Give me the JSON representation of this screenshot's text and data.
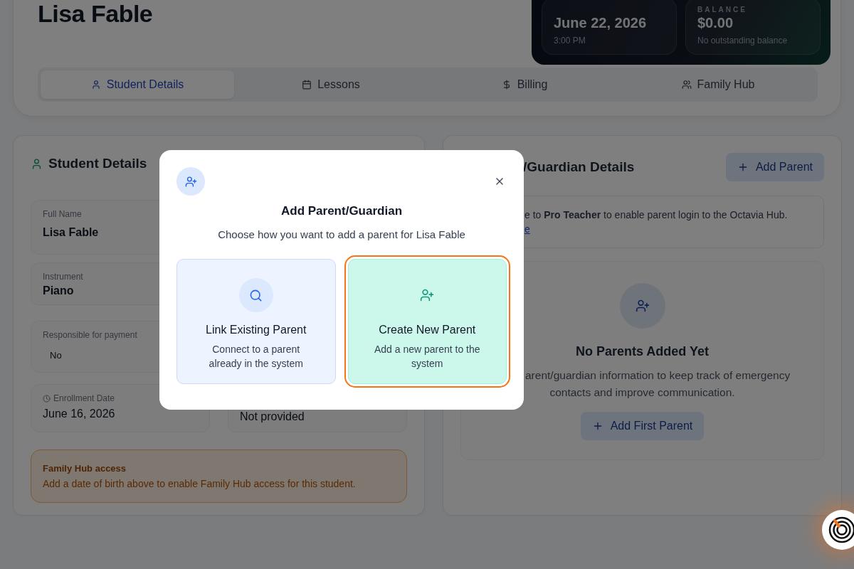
{
  "student_header": {
    "name": "Lisa Fable",
    "next_lesson": {
      "date": "June 22, 2026",
      "time": "3:00 PM"
    },
    "balance": {
      "label": "BALANCE",
      "amount": "$0.00",
      "note": "No outstanding balance"
    }
  },
  "tabs": [
    {
      "label": "Student Details",
      "selected": true
    },
    {
      "label": "Lessons",
      "selected": false
    },
    {
      "label": "Billing",
      "selected": false
    },
    {
      "label": "Family Hub",
      "selected": false
    }
  ],
  "student_details": {
    "title": "Student Details",
    "fields": [
      {
        "label": "Full Name",
        "value": "Lisa Fable",
        "kind": "wide"
      },
      {
        "label": "Instrument",
        "value": "Piano",
        "kind": "wide"
      },
      {
        "label": "Responsible for payment",
        "value": "No",
        "kind": "select"
      },
      {
        "label": "Enrollment Date",
        "value": "June 16, 2026",
        "kind": "date"
      },
      {
        "value": "Not provided",
        "kind": "half"
      }
    ],
    "notice": {
      "title": "Family Hub access",
      "text": "Add a date of birth above to enable Family Hub access for this student."
    }
  },
  "guardian_details": {
    "title": "/Guardian Details",
    "add_button": "Add Parent",
    "upgrade_text": "e to **Pro Teacher** to enable parent login to the Octavia Hub.",
    "upgrade_link": "e",
    "empty": {
      "title": "No Parents Added Yet",
      "description_lines": [
        "arent/guardian information to keep track of emergency",
        "contacts and improve communication."
      ],
      "button": "Add First Parent"
    }
  },
  "modal": {
    "title": "Add Parent/Guardian",
    "subtitle": "Choose how you want to add a parent for Lisa Fable",
    "options": [
      {
        "title": "Link Existing Parent",
        "description": "Connect to a parent already in the system",
        "selected": false
      },
      {
        "title": "Create New Parent",
        "description": "Add a new parent to the system",
        "selected": true
      }
    ]
  }
}
